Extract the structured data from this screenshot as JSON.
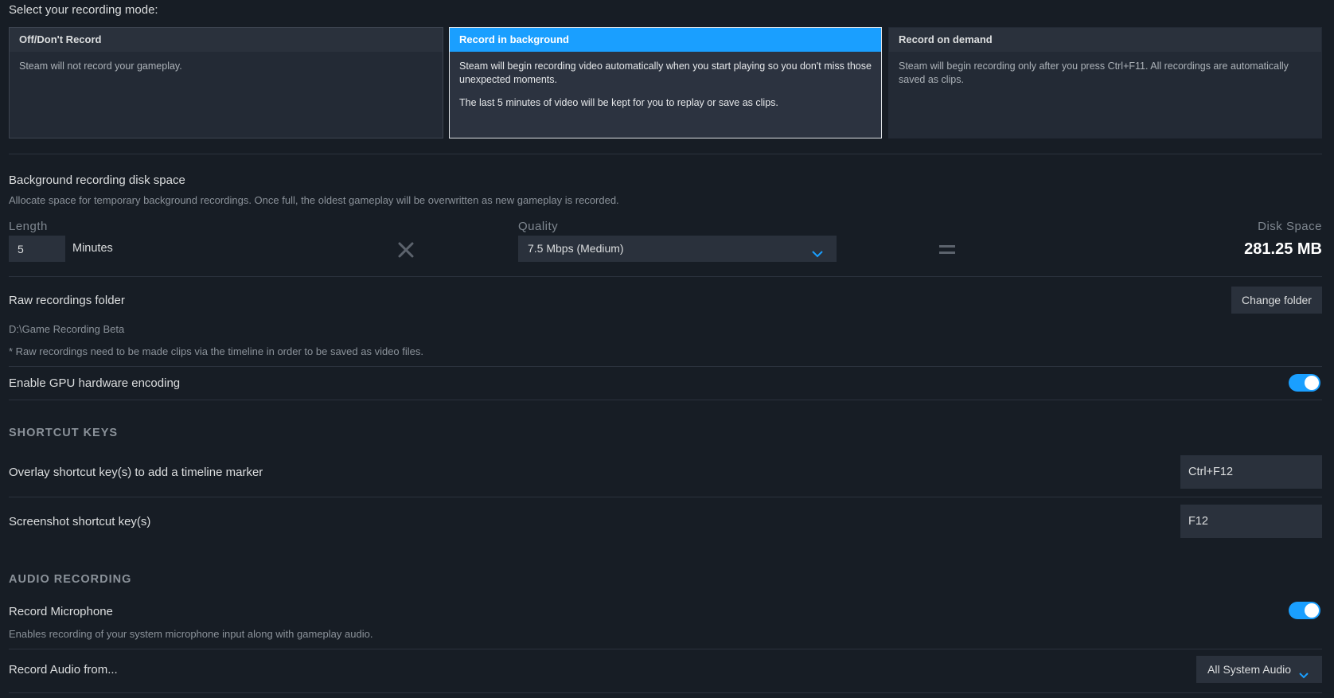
{
  "mode_select": {
    "title": "Select your recording mode:",
    "cards": [
      {
        "label": "Off/Don't Record",
        "body": [
          "Steam will not record your gameplay."
        ]
      },
      {
        "label": "Record in background",
        "body": [
          "Steam will begin recording video automatically when you start playing so you don't miss those unexpected moments.",
          "The last 5 minutes of video will be kept for you to replay or save as clips."
        ],
        "selected": true
      },
      {
        "label": "Record on demand",
        "body": [
          "Steam will begin recording only after you press Ctrl+F11. All recordings are automatically saved as clips."
        ]
      }
    ]
  },
  "disk_space": {
    "title": "Background recording disk space",
    "description": "Allocate space for temporary background recordings. Once full, the oldest gameplay will be overwritten as new gameplay is recorded.",
    "length_label": "Length",
    "length_value": "5",
    "length_unit": "Minutes",
    "quality_label": "Quality",
    "quality_value": "7.5 Mbps (Medium)",
    "disk_label": "Disk Space",
    "disk_value": "281.25 MB"
  },
  "raw_folder": {
    "title": "Raw recordings folder",
    "button_label": "Change folder",
    "path": "D:\\Game Recording Beta",
    "note": "* Raw recordings need to be made clips via the timeline in order to be saved as video files."
  },
  "gpu": {
    "label": "Enable GPU hardware encoding",
    "enabled": true
  },
  "shortcuts": {
    "section_title": "SHORTCUT KEYS",
    "items": [
      {
        "label": "Overlay shortcut key(s) to add a timeline marker",
        "value": "Ctrl+F12"
      },
      {
        "label": "Screenshot shortcut key(s)",
        "value": "F12"
      }
    ]
  },
  "audio": {
    "section_title": "AUDIO RECORDING",
    "mic_label": "Record Microphone",
    "mic_description": "Enables recording of your system microphone input along with gameplay audio.",
    "mic_enabled": true,
    "source_label": "Record Audio from...",
    "source_value": "All System Audio"
  },
  "colors": {
    "background": "#171d25",
    "panel": "#2a313c",
    "accent": "#1a9fff"
  }
}
